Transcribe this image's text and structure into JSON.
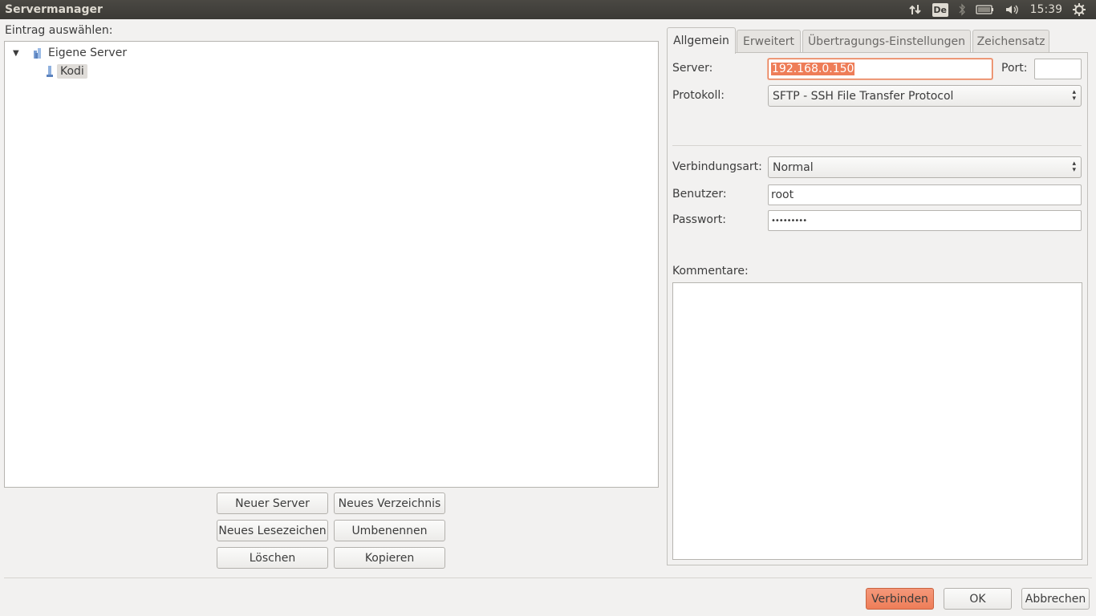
{
  "window": {
    "title": "Servermanager"
  },
  "tray": {
    "keyboard_layout": "De",
    "clock": "15:39"
  },
  "left": {
    "select_label": "Eintrag auswählen:",
    "tree": {
      "root": "Eigene Server",
      "children": [
        "Kodi"
      ]
    },
    "buttons": {
      "new_server": "Neuer Server",
      "new_folder": "Neues Verzeichnis",
      "new_bookmark": "Neues Lesezeichen",
      "rename": "Umbenennen",
      "delete": "Löschen",
      "copy": "Kopieren"
    }
  },
  "tabs": [
    "Allgemein",
    "Erweitert",
    "Übertragungs-Einstellungen",
    "Zeichensatz"
  ],
  "general": {
    "server_label": "Server:",
    "server_value": "192.168.0.150",
    "port_label": "Port:",
    "port_value": "",
    "protocol_label": "Protokoll:",
    "protocol_value": "SFTP - SSH File Transfer Protocol",
    "logon_label": "Verbindungsart:",
    "logon_value": "Normal",
    "user_label": "Benutzer:",
    "user_value": "root",
    "password_label": "Passwort:",
    "password_value": "•••••••••",
    "comments_label": "Kommentare:"
  },
  "dialog_buttons": {
    "connect": "Verbinden",
    "ok": "OK",
    "cancel": "Abbrechen"
  }
}
